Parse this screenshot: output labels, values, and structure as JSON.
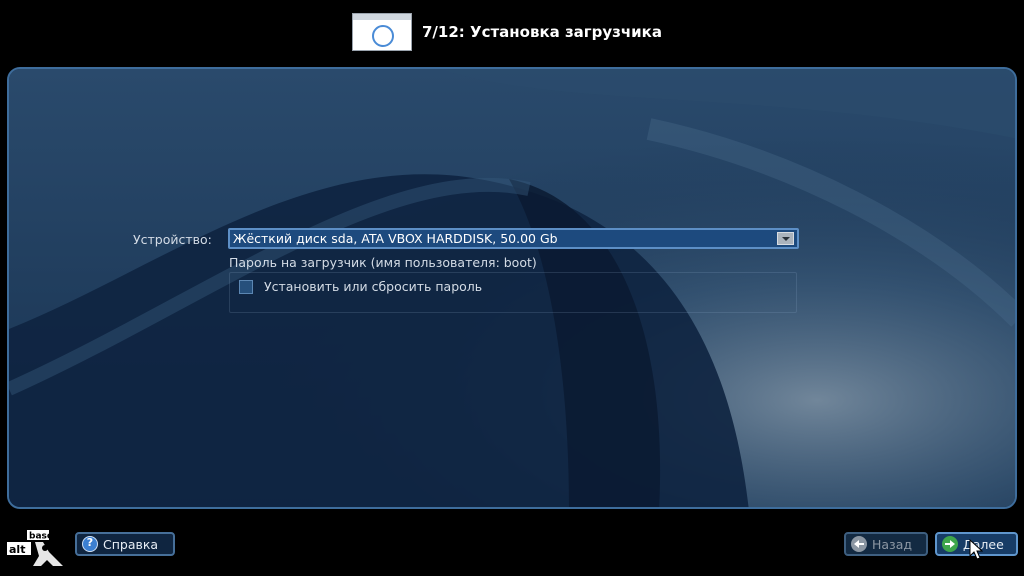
{
  "header": {
    "step_icon": "installer-window-icon",
    "title": "7/12: Установка загрузчика"
  },
  "form": {
    "device_label": "Устройство:",
    "device_value": "Жёсткий диск sda, ATA VBOX HARDDISK, 50.00 Gb",
    "password_caption": "Пароль на загрузчик (имя пользователя: boot)",
    "set_password_label": "Установить или сбросить пароль",
    "set_password_checked": false
  },
  "footer": {
    "logo_text_top": "base",
    "logo_text_bottom": "alt",
    "help_label": "Справка",
    "help_icon": "?",
    "back_label": "Назад",
    "next_label": "Далее"
  },
  "colors": {
    "panel_border": "#3e6d9c",
    "select_bg": "#1d4a7e",
    "next_icon": "#3fa64b"
  }
}
